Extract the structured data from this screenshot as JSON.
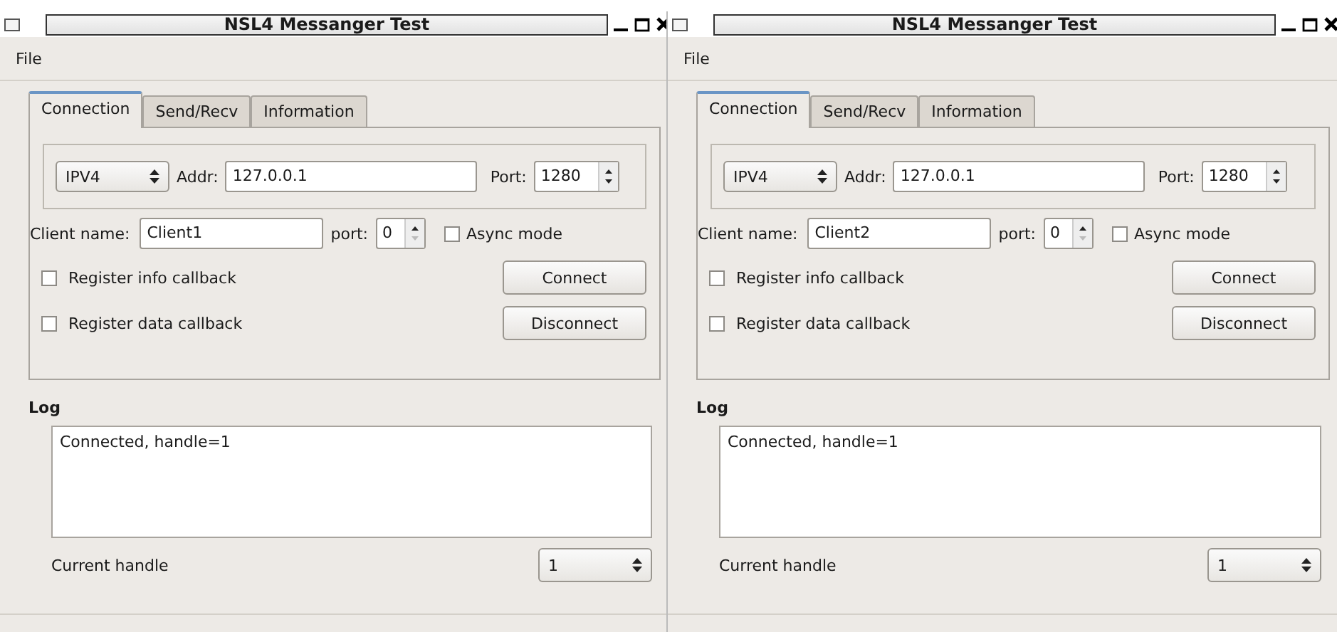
{
  "windows": [
    {
      "title": "NSL4 Messanger Test",
      "menu": [
        "File"
      ],
      "tabs": [
        {
          "label": "Connection",
          "selected": true
        },
        {
          "label": "Send/Recv",
          "selected": false
        },
        {
          "label": "Information",
          "selected": false
        }
      ],
      "protocol": "IPV4",
      "addr_label": "Addr:",
      "addr": "127.0.0.1",
      "port_label": "Port:",
      "port": "1280",
      "client_name_label": "Client name:",
      "client_name": "Client1",
      "local_port_label": "port:",
      "local_port": "0",
      "async": {
        "label": "Async mode",
        "checked": false
      },
      "callbacks": [
        {
          "label": "Register info callback",
          "checked": false
        },
        {
          "label": "Register data callback",
          "checked": false
        }
      ],
      "buttons": [
        "Connect",
        "Disconnect"
      ],
      "log_label": "Log",
      "log": "Connected, handle=1",
      "handle_label": "Current handle",
      "handle": "1"
    },
    {
      "title": "NSL4 Messanger Test",
      "menu": [
        "File"
      ],
      "tabs": [
        {
          "label": "Connection",
          "selected": true
        },
        {
          "label": "Send/Recv",
          "selected": false
        },
        {
          "label": "Information",
          "selected": false
        }
      ],
      "protocol": "IPV4",
      "addr_label": "Addr:",
      "addr": "127.0.0.1",
      "port_label": "Port:",
      "port": "1280",
      "client_name_label": "Client name:",
      "client_name": "Client2",
      "local_port_label": "port:",
      "local_port": "0",
      "async": {
        "label": "Async mode",
        "checked": false
      },
      "callbacks": [
        {
          "label": "Register info callback",
          "checked": false
        },
        {
          "label": "Register data callback",
          "checked": false
        }
      ],
      "buttons": [
        "Connect",
        "Disconnect"
      ],
      "log_label": "Log",
      "log": "Connected, handle=1",
      "handle_label": "Current handle",
      "handle": "1"
    }
  ]
}
